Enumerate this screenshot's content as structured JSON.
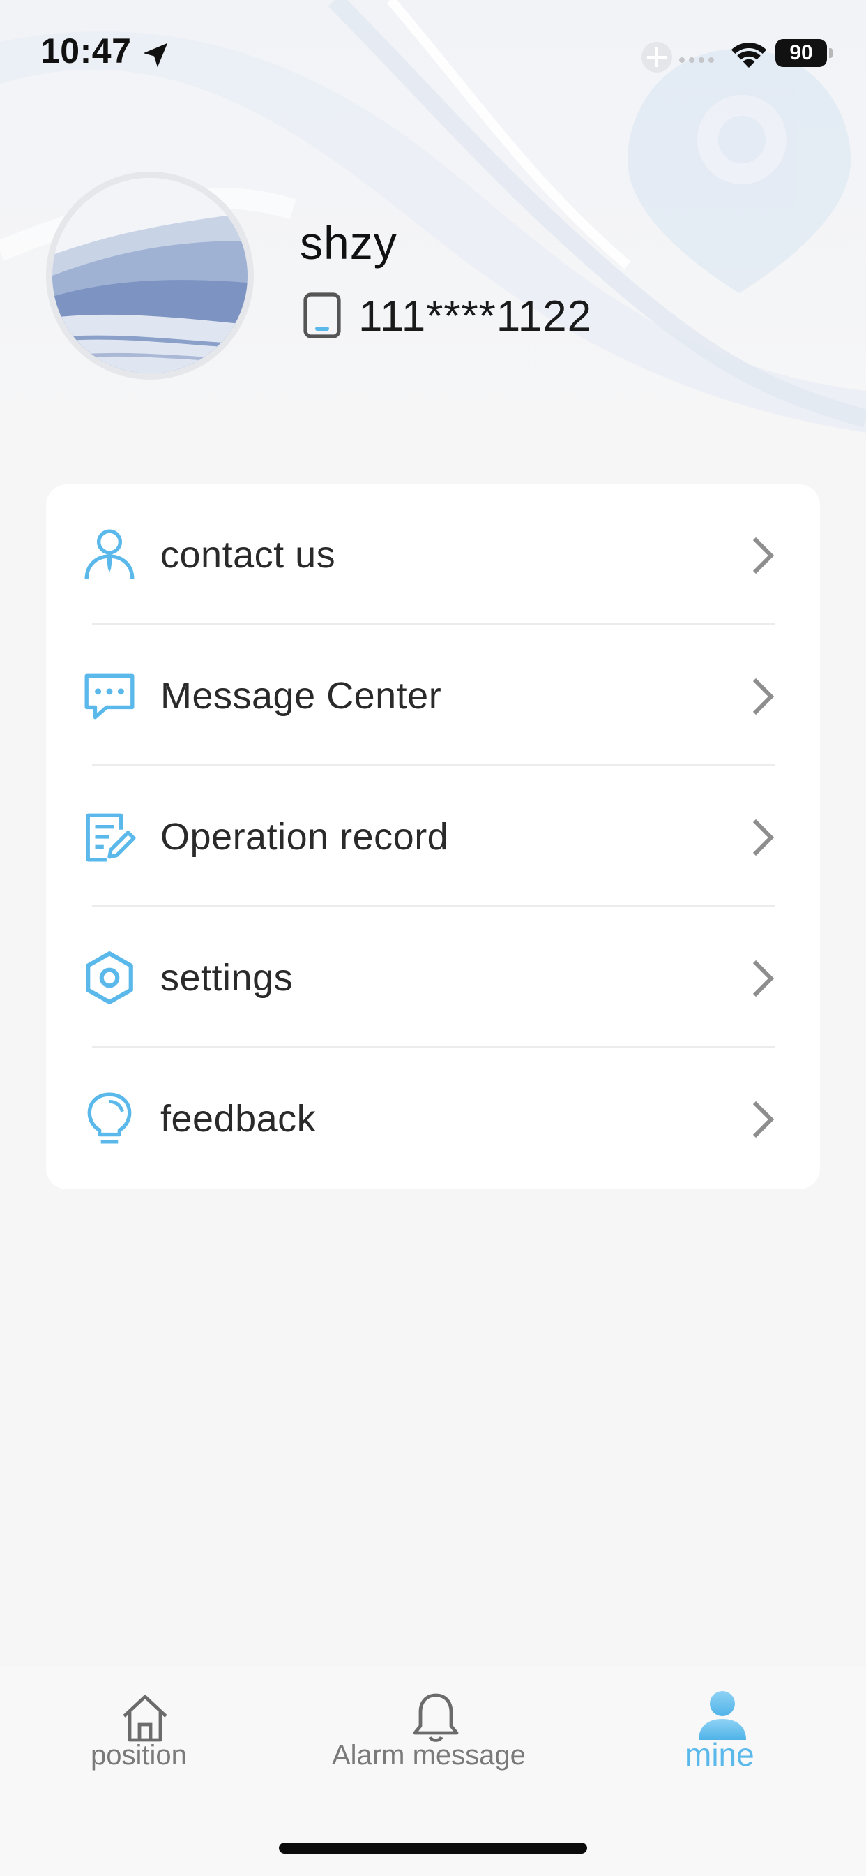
{
  "status_bar": {
    "time": "10:47",
    "battery": "90",
    "icons": [
      "location-arrow-icon",
      "add-circle-icon",
      "signal-dots-icon",
      "wifi-icon",
      "battery-icon"
    ]
  },
  "profile": {
    "username": "shzy",
    "phone": "111****1122",
    "icons": [
      "avatar-image",
      "phone-icon"
    ]
  },
  "menu": {
    "items": [
      {
        "label": "contact us",
        "icon": "person-tie-icon"
      },
      {
        "label": "Message Center",
        "icon": "chat-bubble-icon"
      },
      {
        "label": "Operation record",
        "icon": "document-edit-icon"
      },
      {
        "label": "settings",
        "icon": "hexagon-gear-icon"
      },
      {
        "label": "feedback",
        "icon": "lightbulb-icon"
      }
    ],
    "chevron_icon": "chevron-right-icon"
  },
  "tab_bar": {
    "tabs": [
      {
        "label": "position",
        "icon": "house-icon",
        "active": false
      },
      {
        "label": "Alarm message",
        "icon": "bell-icon",
        "active": false
      },
      {
        "label": "mine",
        "icon": "person-filled-icon",
        "active": true
      }
    ]
  },
  "colors": {
    "accent": "#5ab9ea",
    "text_primary": "#2a2a2a",
    "tab_inactive": "#7a7a7a",
    "background": "#f6f6f7",
    "card": "#ffffff"
  }
}
